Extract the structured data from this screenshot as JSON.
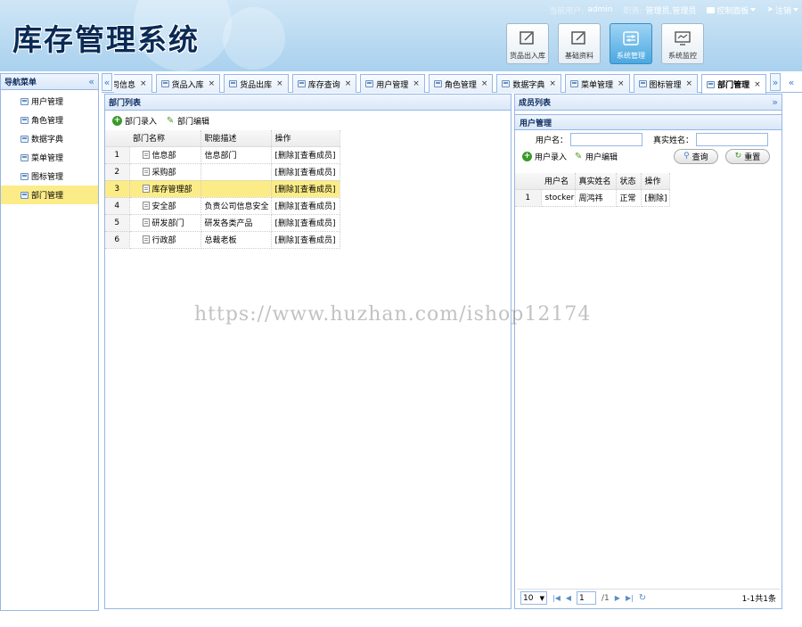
{
  "header": {
    "title": "库存管理系统",
    "current_user_label": "当前用户:",
    "current_user": "admin",
    "role_label": "职务:",
    "role": "管理员,管理员",
    "control_panel": "控制面板",
    "logout": "注销"
  },
  "modules": [
    {
      "label": "货品出入库",
      "icon": "edit-icon"
    },
    {
      "label": "基础资料",
      "icon": "edit-icon"
    },
    {
      "label": "系统管理",
      "icon": "settings-icon"
    },
    {
      "label": "系统监控",
      "icon": "monitor-icon"
    }
  ],
  "sidebar": {
    "title": "导航菜单",
    "items": [
      {
        "label": "用户管理"
      },
      {
        "label": "角色管理"
      },
      {
        "label": "数据字典"
      },
      {
        "label": "菜单管理"
      },
      {
        "label": "图标管理"
      },
      {
        "label": "部门管理"
      }
    ]
  },
  "tabs": [
    {
      "label": "公司信息"
    },
    {
      "label": "货品入库"
    },
    {
      "label": "货品出库"
    },
    {
      "label": "库存查询"
    },
    {
      "label": "用户管理"
    },
    {
      "label": "角色管理"
    },
    {
      "label": "数据字典"
    },
    {
      "label": "菜单管理"
    },
    {
      "label": "图标管理"
    },
    {
      "label": "部门管理"
    }
  ],
  "dept_panel": {
    "title": "部门列表",
    "add_label": "部门录入",
    "edit_label": "部门编辑",
    "columns": [
      "部门名称",
      "职能描述",
      "操作"
    ],
    "rows": [
      {
        "num": "1",
        "name": "信息部",
        "desc": "信息部门",
        "ops": "[删除][查看成员]"
      },
      {
        "num": "2",
        "name": "采购部",
        "desc": "",
        "ops": "[删除][查看成员]"
      },
      {
        "num": "3",
        "name": "库存管理部",
        "desc": "",
        "ops": "[删除][查看成员]"
      },
      {
        "num": "4",
        "name": "安全部",
        "desc": "负责公司信息安全",
        "ops": "[删除][查看成员]"
      },
      {
        "num": "5",
        "name": "研发部门",
        "desc": "研发各类产品",
        "ops": "[删除][查看成员]"
      },
      {
        "num": "6",
        "name": "行政部",
        "desc": "总裁老板",
        "ops": "[删除][查看成员]"
      }
    ]
  },
  "member_panel": {
    "title": "成员列表",
    "sub_title": "用户管理",
    "username_label": "用户名：",
    "realname_label": "真实姓名：",
    "username_value": "",
    "realname_value": "",
    "add_label": "用户录入",
    "edit_label": "用户编辑",
    "query_label": "查询",
    "reset_label": "重置",
    "columns": [
      "用户名",
      "真实姓名",
      "状态",
      "操作"
    ],
    "rows": [
      {
        "num": "1",
        "username": "stocker",
        "realname": "周鸿祎",
        "status": "正常",
        "ops": "[删除]"
      }
    ],
    "pager": {
      "page_size": "10",
      "page": "1",
      "total_pages": "/1",
      "summary": "1-1共1条"
    }
  },
  "watermark": "https://www.huzhan.com/ishop12174",
  "colors": {
    "border": "#95b8e7",
    "selected": "#fbec88",
    "header_bg": "#a9d1ee"
  }
}
